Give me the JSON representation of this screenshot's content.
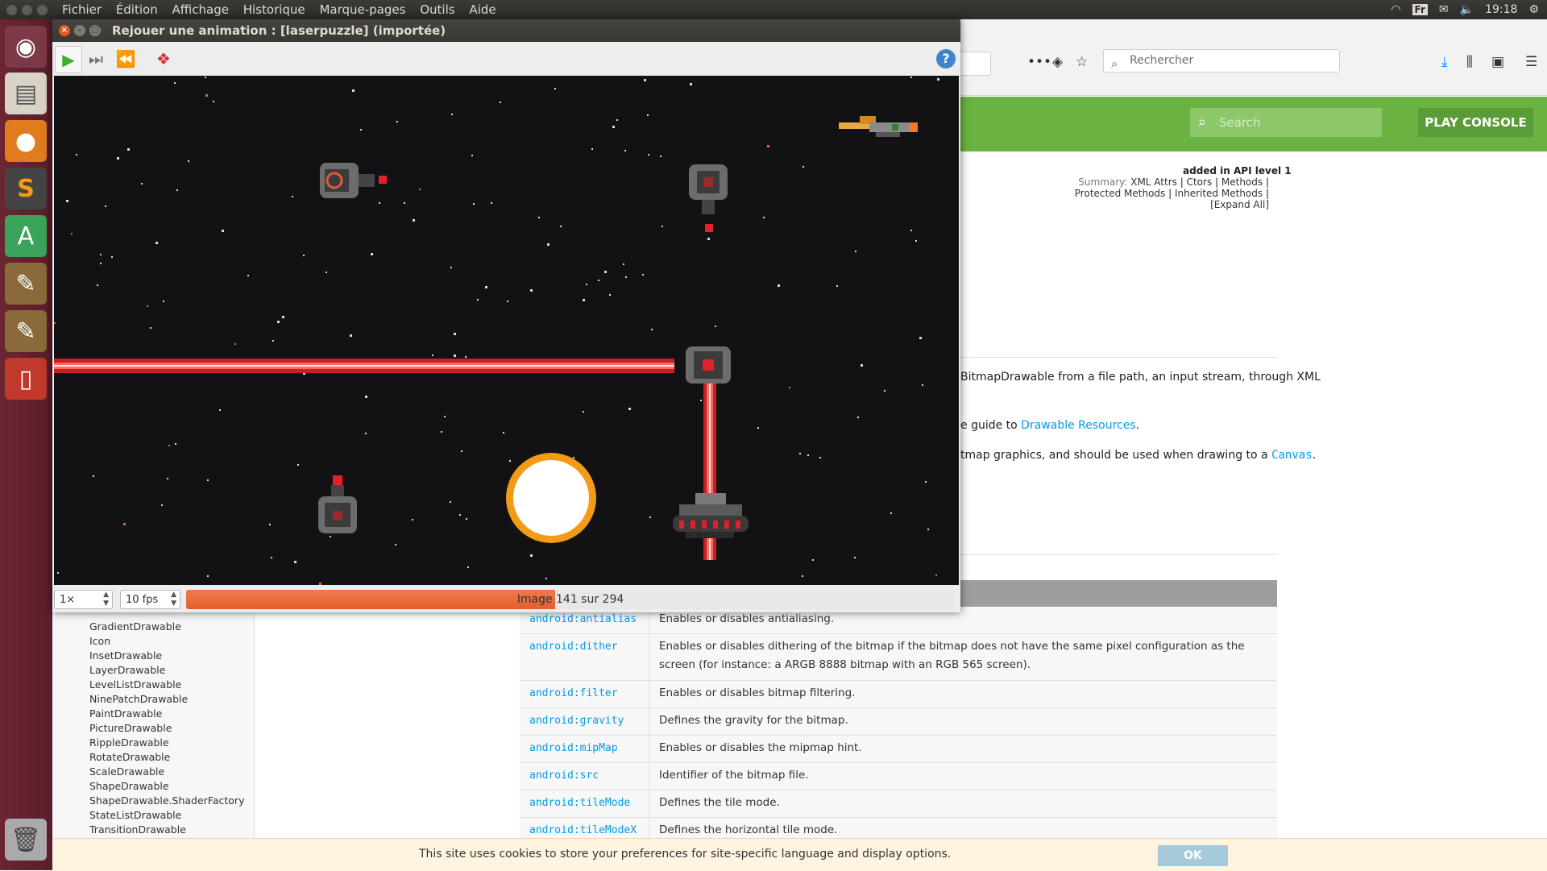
{
  "topbar": {
    "menus": [
      "Fichier",
      "Édition",
      "Affichage",
      "Historique",
      "Marque-pages",
      "Outils",
      "Aide"
    ],
    "keyboard": "Fr",
    "clock": "19:18"
  },
  "launcher": {
    "items": [
      "ubuntu-home-icon",
      "files-icon",
      "firefox-icon",
      "sublime-text-icon",
      "android-studio-icon",
      "gimp-icon",
      "gimp-icon",
      "phone-icon",
      "trash-icon"
    ]
  },
  "browser": {
    "search_placeholder": "Rechercher",
    "site_search_placeholder": "Search",
    "play_console": "PLAY CONSOLE",
    "api_level": "added in API level 1",
    "summary_label": "Summary:",
    "summary_links": [
      "XML Attrs",
      "Ctors",
      "Methods",
      "Protected Methods",
      "Inherited Methods",
      "[Expand All]"
    ],
    "paragraph1": "BitmapDrawable from a file path, an input stream, through XML",
    "paragraph2_prefix": "e guide to ",
    "paragraph2_link": "Drawable Resources",
    "paragraph3_prefix": "tmap graphics, and should be used when drawing to a ",
    "paragraph3_code": "Canvas",
    "nav_items": [
      "GradientDrawable",
      "Icon",
      "InsetDrawable",
      "LayerDrawable",
      "LevelListDrawable",
      "NinePatchDrawable",
      "PaintDrawable",
      "PictureDrawable",
      "RippleDrawable",
      "RotateDrawable",
      "ScaleDrawable",
      "ShapeDrawable",
      "ShapeDrawable.ShaderFactory",
      "StateListDrawable",
      "TransitionDrawable"
    ],
    "attrs": [
      {
        "name": "android:antialias",
        "desc": "Enables or disables antialiasing."
      },
      {
        "name": "android:dither",
        "desc": "Enables or disables dithering of the bitmap if the bitmap does not have the same pixel configuration as the screen (for instance: a ARGB 8888 bitmap with an RGB 565 screen)."
      },
      {
        "name": "android:filter",
        "desc": "Enables or disables bitmap filtering."
      },
      {
        "name": "android:gravity",
        "desc": "Defines the gravity for the bitmap."
      },
      {
        "name": "android:mipMap",
        "desc": "Enables or disables the mipmap hint."
      },
      {
        "name": "android:src",
        "desc": "Identifier of the bitmap file."
      },
      {
        "name": "android:tileMode",
        "desc": "Defines the tile mode."
      },
      {
        "name": "android:tileModeX",
        "desc": "Defines the horizontal tile mode."
      }
    ],
    "cookie_text": "This site uses cookies to store your preferences for site-specific language and display options.",
    "cookie_ok": "OK"
  },
  "animation_window": {
    "title": "Rejouer une animation :  [laserpuzzle] (importée)",
    "zoom": "1×",
    "fps": "10 fps",
    "frame_label": "Image 141 sur 294",
    "frame_current": 141,
    "frame_total": 294
  },
  "colors": {
    "accent_green": "#6ab343",
    "progress": "#e35f2d",
    "laser": "#e0202a",
    "launcher": "#6b2533"
  }
}
